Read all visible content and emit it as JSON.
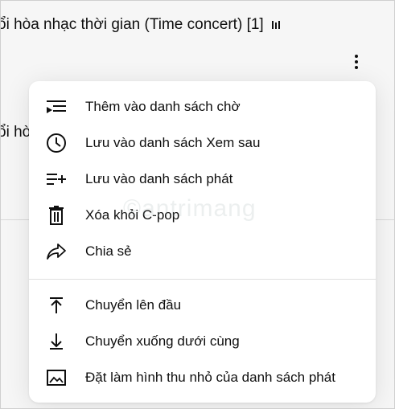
{
  "background": {
    "title": "ổi hòa nhạc thời gian (Time concert) [1]",
    "title2": "ổi hò",
    "more_icon": "kebab-vertical-icon",
    "playing_icon": "equalizer-bars-icon"
  },
  "menu": {
    "items": [
      {
        "icon": "add-to-queue-icon",
        "label": "Thêm vào danh sách chờ"
      },
      {
        "icon": "clock-icon",
        "label": "Lưu vào danh sách Xem sau"
      },
      {
        "icon": "playlist-add-icon",
        "label": "Lưu vào danh sách phát"
      },
      {
        "icon": "trash-icon",
        "label": "Xóa khỏi C-pop"
      },
      {
        "icon": "share-icon",
        "label": "Chia sẻ"
      },
      {
        "icon": "move-to-top-icon",
        "label": "Chuyển lên đầu"
      },
      {
        "icon": "move-to-bottom-icon",
        "label": "Chuyển xuống dưới cùng"
      },
      {
        "icon": "image-icon",
        "label": "Đặt làm hình thu nhỏ của danh sách phát"
      }
    ]
  },
  "watermark": "©antrimang"
}
